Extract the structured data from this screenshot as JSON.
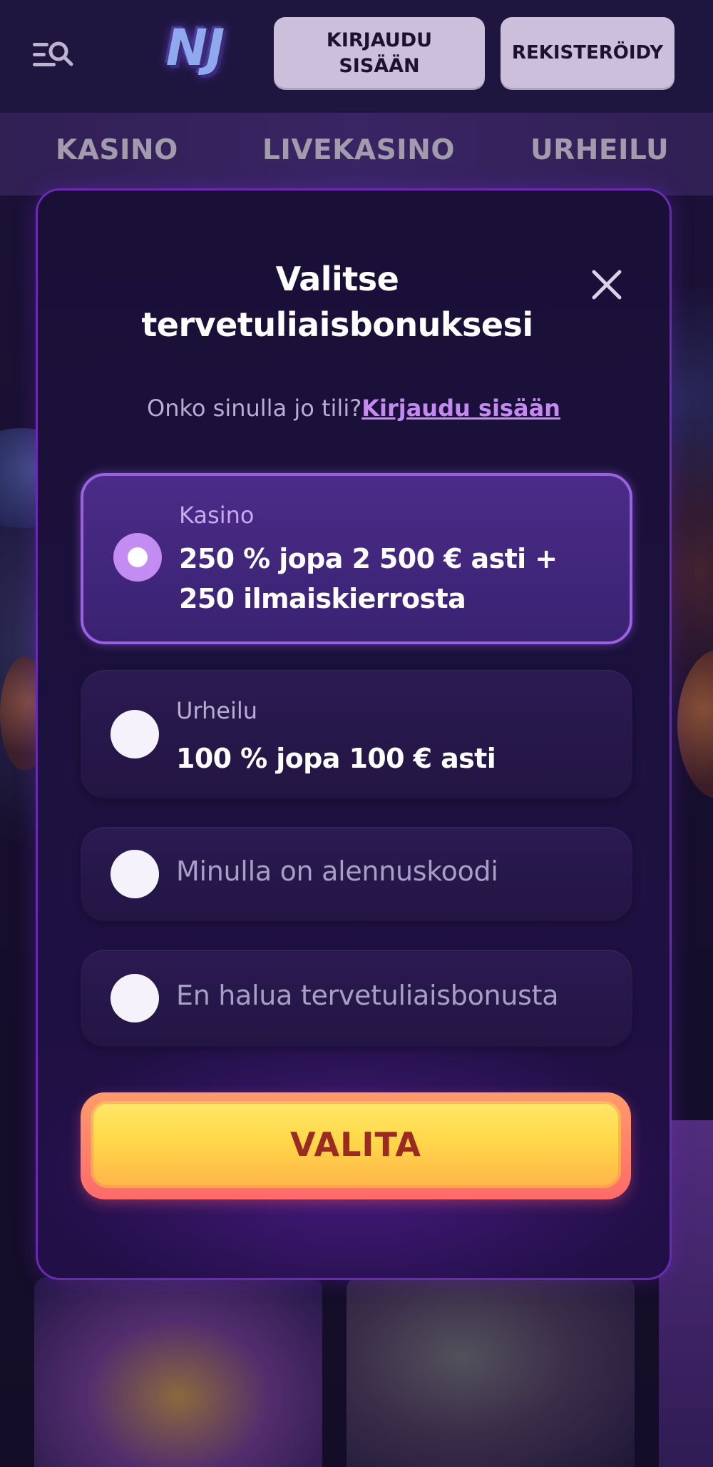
{
  "header": {
    "logo_text": "NJ",
    "login_label": "KIRJAUDU SISÄÄN",
    "register_label": "REKISTERÖIDY"
  },
  "nav": {
    "items": [
      {
        "label": "KASINO"
      },
      {
        "label": "LIVEKASINO"
      },
      {
        "label": "URHEILU"
      }
    ]
  },
  "modal": {
    "title": "Valitse tervetuliaisbonuksesi",
    "prompt_text": "Onko sinulla jo tili?",
    "login_link": "Kirjaudu sisään",
    "options": [
      {
        "category": "Kasino",
        "text": "250 % jopa 2 500 € asti + 250 ilmaiskierrosta",
        "selected": true
      },
      {
        "category": "Urheilu",
        "text": "100 % jopa 100 € asti",
        "selected": false
      },
      {
        "text": "Minulla on alennuskoodi",
        "selected": false
      },
      {
        "text": "En halua tervetuliaisbonusta",
        "selected": false
      }
    ],
    "cta_label": "VALITA"
  },
  "colors": {
    "background": "#1a0f35",
    "accent_purple": "#9a62e0",
    "cta_yellow": "#ffd84a",
    "cta_text": "#9a2a22"
  },
  "icons": {
    "menu": "menu-search-icon",
    "close": "close-icon"
  }
}
